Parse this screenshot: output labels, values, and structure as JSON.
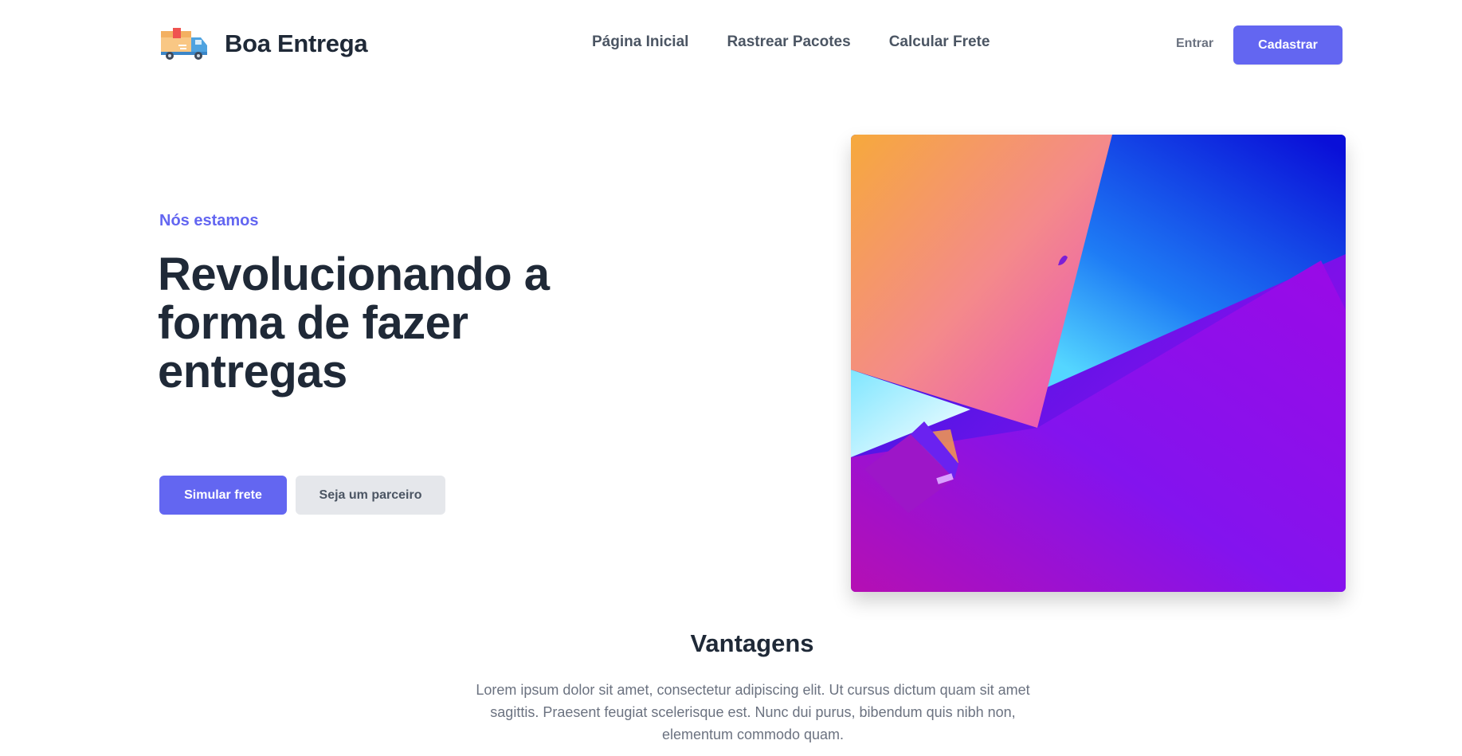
{
  "header": {
    "brand": "Boa Entrega",
    "logo_icon": "delivery-truck-icon",
    "nav": [
      {
        "label": "Página Inicial"
      },
      {
        "label": "Rastrear Pacotes"
      },
      {
        "label": "Calcular Frete"
      }
    ],
    "login_label": "Entrar",
    "signup_label": "Cadastrar"
  },
  "hero": {
    "eyebrow": "Nós estamos",
    "title": "Revolucionando a forma de fazer entregas",
    "primary_cta": "Simular frete",
    "secondary_cta": "Seja um parceiro"
  },
  "features": {
    "title": "Vantagens",
    "description": "Lorem ipsum dolor sit amet, consectetur adipiscing elit. Ut cursus dictum quam sit amet sagittis. Praesent feugiat scelerisque est. Nunc dui purus, bibendum quis nibh non, elementum commodo quam."
  },
  "colors": {
    "accent": "#6366f1",
    "text_dark": "#1f2937",
    "text_muted": "#6b7280",
    "secondary_button_bg": "#e5e7eb"
  }
}
